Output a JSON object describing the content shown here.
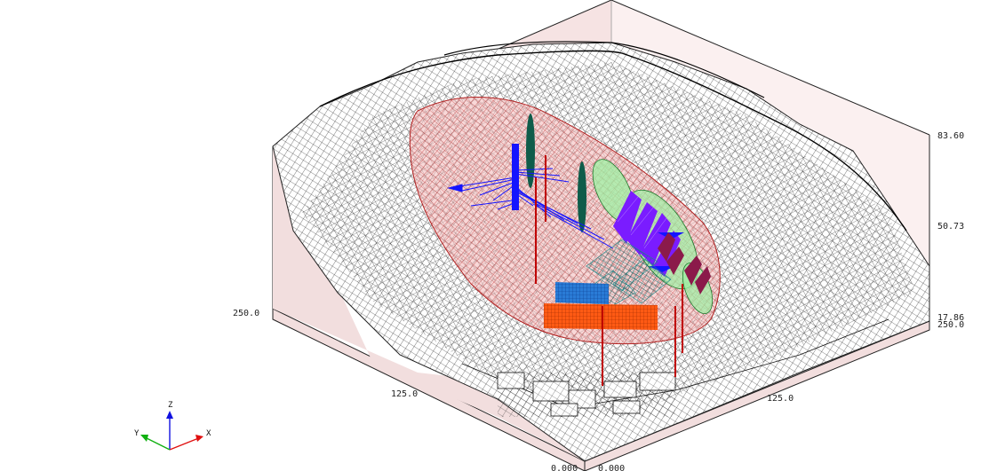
{
  "scene": {
    "background": "#ffffff",
    "box_fill": "#f2dede",
    "box_edge": "#222222",
    "terrain_wire_color": "#111111",
    "slip_surface_fill": "#f4b8b8",
    "slip_surface_wire": "#b22222",
    "colors": {
      "dark_green": "#0f5c4a",
      "light_green": "#9df0a3",
      "blue": "#1414ff",
      "violet": "#7a1cff",
      "maroon": "#8b1a4a",
      "teal": "#1c8a8a",
      "steel_blue": "#2a7bd6",
      "orange": "#ff5a14",
      "red": "#c00000"
    }
  },
  "axes": {
    "z_ticks": [
      "83.60",
      "50.73",
      "17.86"
    ],
    "y_ticks": [
      "250.0",
      "125.0"
    ],
    "x_ticks": [
      "250.0",
      "125.0"
    ],
    "origin_left": "0.000",
    "origin_right": "0.000"
  },
  "triad": {
    "x_label": "X",
    "y_label": "Y",
    "z_label": "Z",
    "x_color": "#e01010",
    "y_color": "#10b010",
    "z_color": "#1010e0"
  }
}
